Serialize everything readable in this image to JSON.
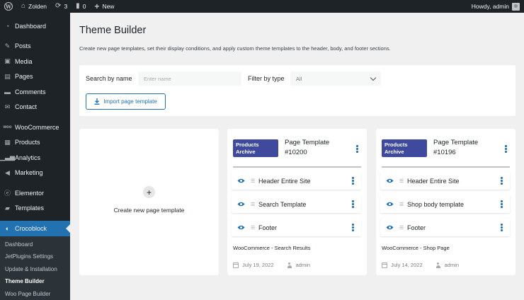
{
  "adminbar": {
    "site_name": "Zolden",
    "updates_count": "3",
    "comments_count": "0",
    "new_label": "New",
    "howdy": "Howdy, admin"
  },
  "sidebar": {
    "items": [
      {
        "label": "Dashboard",
        "icon": "dashboard-icon"
      },
      {
        "label": "Posts",
        "icon": "pin-icon"
      },
      {
        "label": "Media",
        "icon": "media-icon"
      },
      {
        "label": "Pages",
        "icon": "pages-icon"
      },
      {
        "label": "Comments",
        "icon": "comments-icon"
      },
      {
        "label": "Contact",
        "icon": "mail-icon"
      },
      {
        "label": "WooCommerce",
        "icon": "woo-icon"
      },
      {
        "label": "Products",
        "icon": "products-icon"
      },
      {
        "label": "Analytics",
        "icon": "analytics-icon"
      },
      {
        "label": "Marketing",
        "icon": "megaphone-icon"
      },
      {
        "label": "Elementor",
        "icon": "elementor-icon"
      },
      {
        "label": "Templates",
        "icon": "folder-icon"
      },
      {
        "label": "Crocoblock",
        "icon": "crocoblock-icon"
      }
    ],
    "submenu": [
      {
        "label": "Dashboard"
      },
      {
        "label": "JetPlugins Settings"
      },
      {
        "label": "Update & Installation"
      },
      {
        "label": "Theme Builder"
      },
      {
        "label": "Woo Page Builder"
      }
    ]
  },
  "page": {
    "title": "Theme Builder",
    "description": "Create new page templates, set their display conditions, and apply custom theme templates to the header, body, and footer sections."
  },
  "filters": {
    "search_label": "Search by name",
    "search_placeholder": "Enter name",
    "type_label": "Filter by type",
    "type_value": "All",
    "import_label": "Import page template"
  },
  "create_card": {
    "label": "Create new page template"
  },
  "templates": [
    {
      "badge_line1": "Products",
      "badge_line2": "Archive",
      "title_line1": "Page Template",
      "title_line2": "#10200",
      "conditions": [
        "Header Entire Site",
        "Search Template",
        "Footer"
      ],
      "type": "WooCommerce - Search Results",
      "date": "July 19, 2022",
      "author": "admin"
    },
    {
      "badge_line1": "Products",
      "badge_line2": "Archive",
      "title_line1": "Page Template",
      "title_line2": "#10196",
      "conditions": [
        "Header Entire Site",
        "Shop body template",
        "Footer"
      ],
      "type": "WooCommerce - Shop Page",
      "date": "July 14, 2022",
      "author": "admin"
    }
  ],
  "colors": {
    "accent": "#2271b1",
    "badge": "#3f4a9f",
    "admin_bg": "#1d2327"
  }
}
